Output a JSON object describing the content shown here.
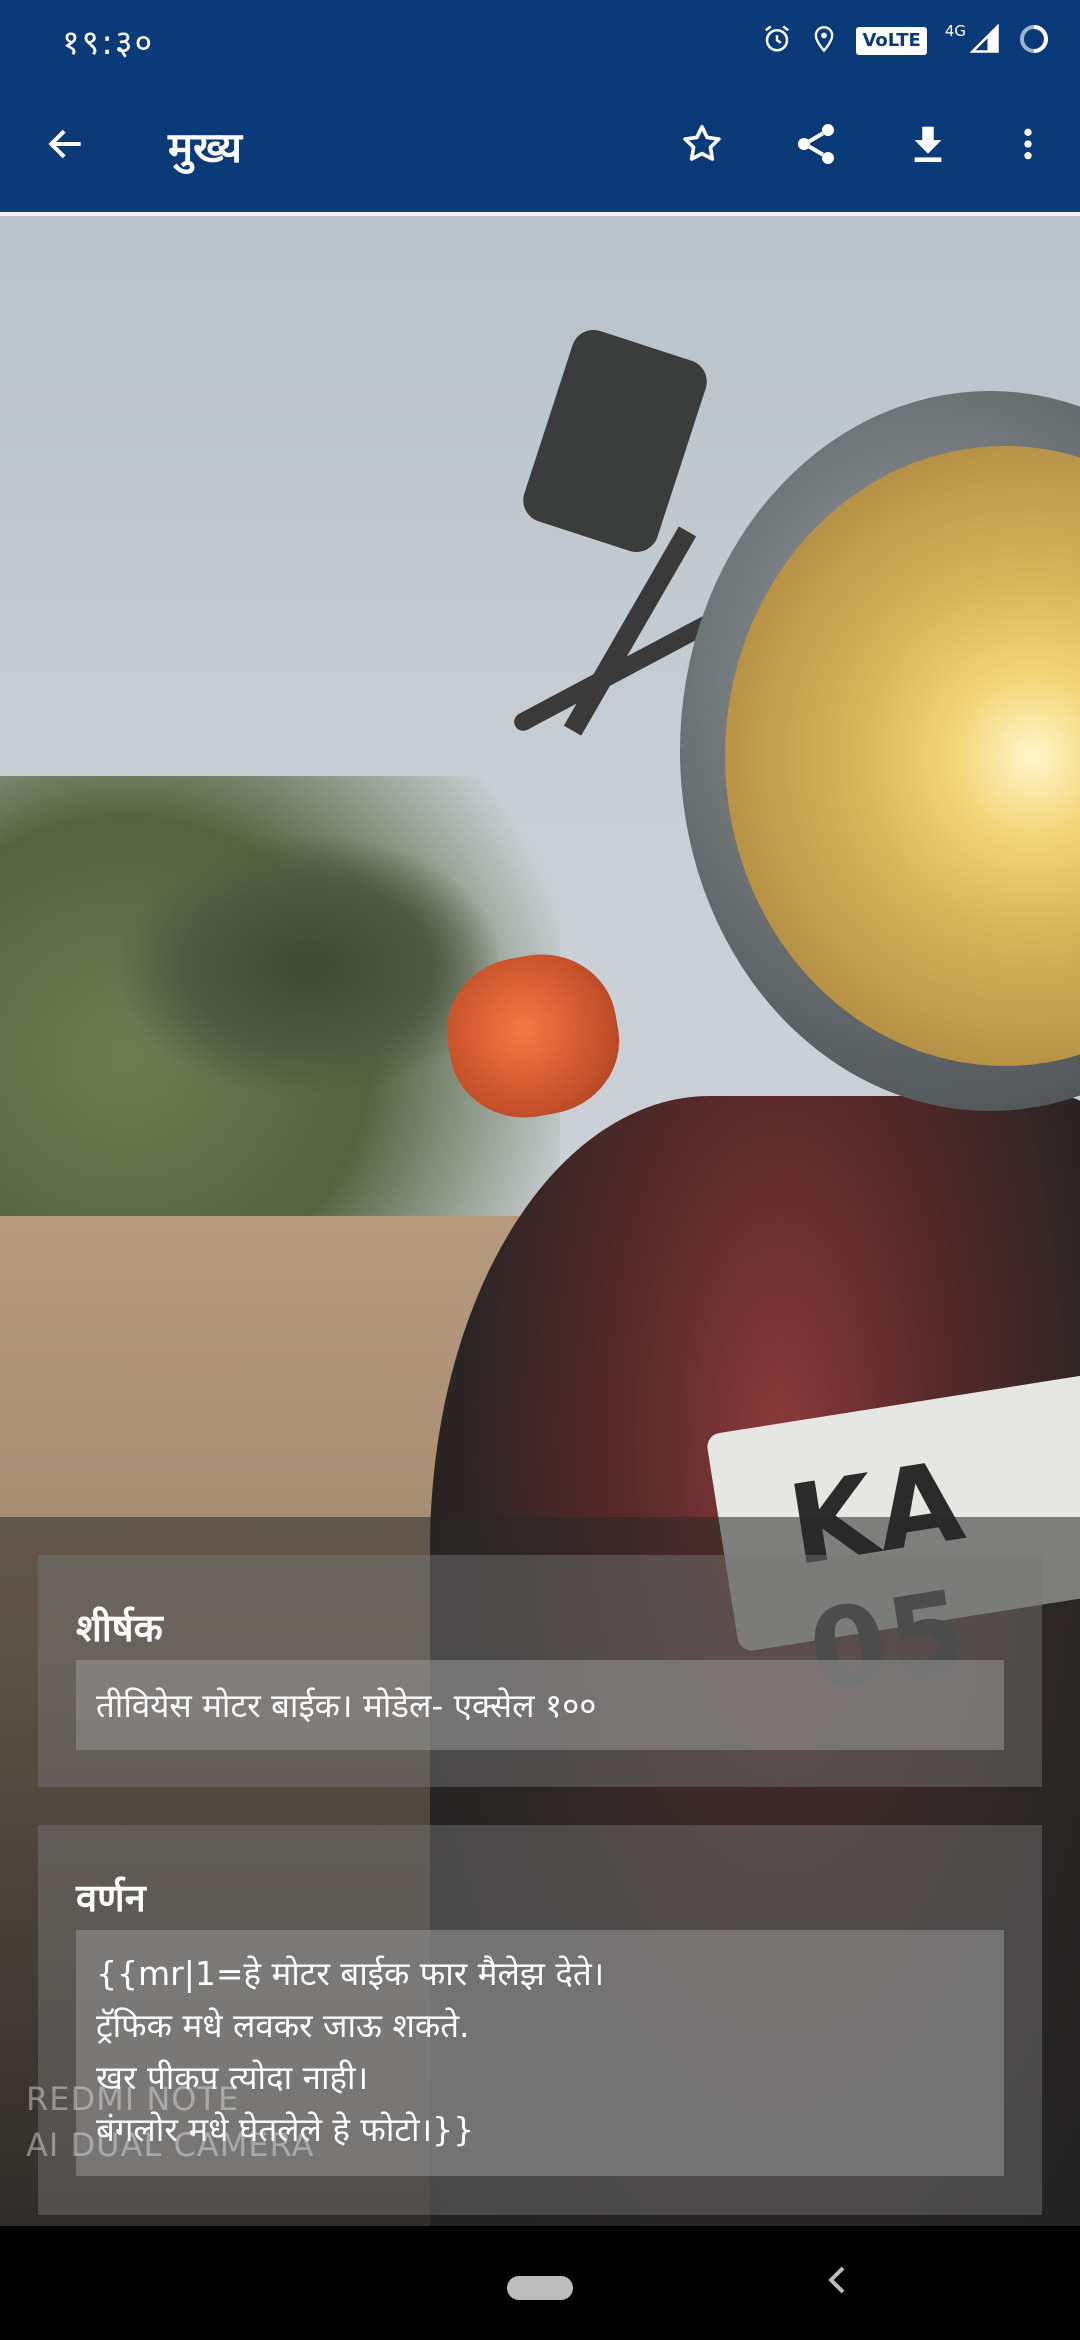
{
  "status_bar": {
    "time": "१९:३०",
    "volte": "VoLTE",
    "network": "4G"
  },
  "app_bar": {
    "title": "मुख्य",
    "back_icon": "arrow-back-icon",
    "star_icon": "star-outline-icon",
    "share_icon": "share-icon",
    "download_icon": "download-icon",
    "more_icon": "more-vert-icon"
  },
  "photo": {
    "plate_text": "KA 05",
    "watermark_line1": "REDMI NOTE",
    "watermark_line2": "AI DUAL CAMERA"
  },
  "title_section": {
    "label": "शीर्षक",
    "value": "तीवियेस मोटर बाईक। मोडेल- एक्सेल १००"
  },
  "description_section": {
    "label": "वर्णन",
    "lines": [
      "{{mr|1=हे मोटर बाईक फार मैलेझ देते।",
      "ट्रॅफिक मधे लवकर जाऊ शकते.",
      "खर पीकप त्योदा नाही।",
      "बंगलोर मधे घेतलेले हे फोटो।}}"
    ]
  },
  "colors": {
    "app_bar_bg": "#0a3a78",
    "text": "#ffffff"
  }
}
